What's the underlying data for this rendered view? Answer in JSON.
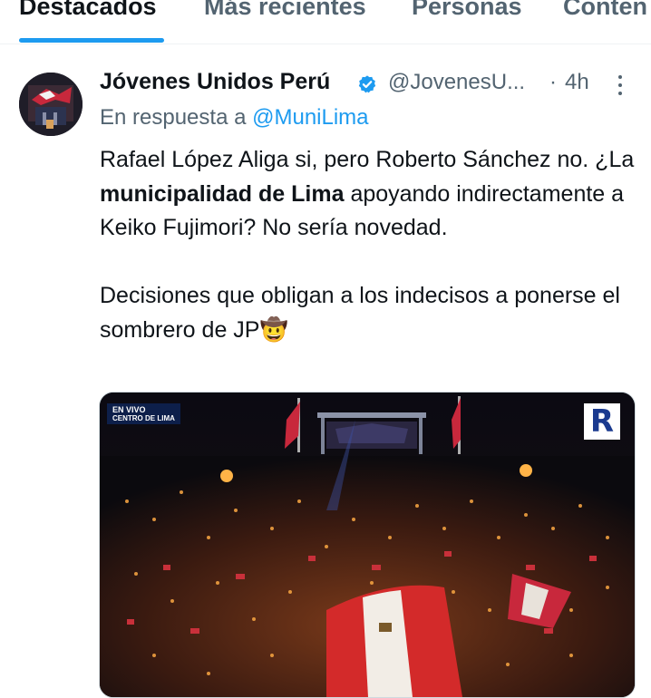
{
  "tabs": [
    {
      "label": "Destacados",
      "active": true
    },
    {
      "label": "Más recientes",
      "active": false
    },
    {
      "label": "Personas",
      "active": false
    },
    {
      "label": "Conten",
      "active": false
    }
  ],
  "tweet": {
    "author": "Jóvenes Unidos Perú",
    "handle": "@JovenesU...",
    "separator": "·",
    "time": "4h",
    "reply_prefix": "En respuesta a",
    "reply_to": "@MuniLima",
    "body": {
      "p1_part1": "Rafael López Aliga si, pero Roberto Sánchez no. ¿La ",
      "p1_bold": "municipalidad de Lima",
      "p1_part2": " apoyando indirectamente a Keiko Fujimori? No sería novedad.",
      "p2": "Decisiones que obligan a los indecisos a ponerse el sombrero de JP🤠"
    },
    "media": {
      "live_label": "EN VIVO",
      "location_label": "CENTRO DE LIMA",
      "logo_letter": "R"
    }
  },
  "colors": {
    "accent": "#1d9bf0",
    "text": "#0f1419",
    "muted": "#536471"
  },
  "icons": {
    "verified": "verified-badge-icon",
    "more": "more-options-icon"
  }
}
